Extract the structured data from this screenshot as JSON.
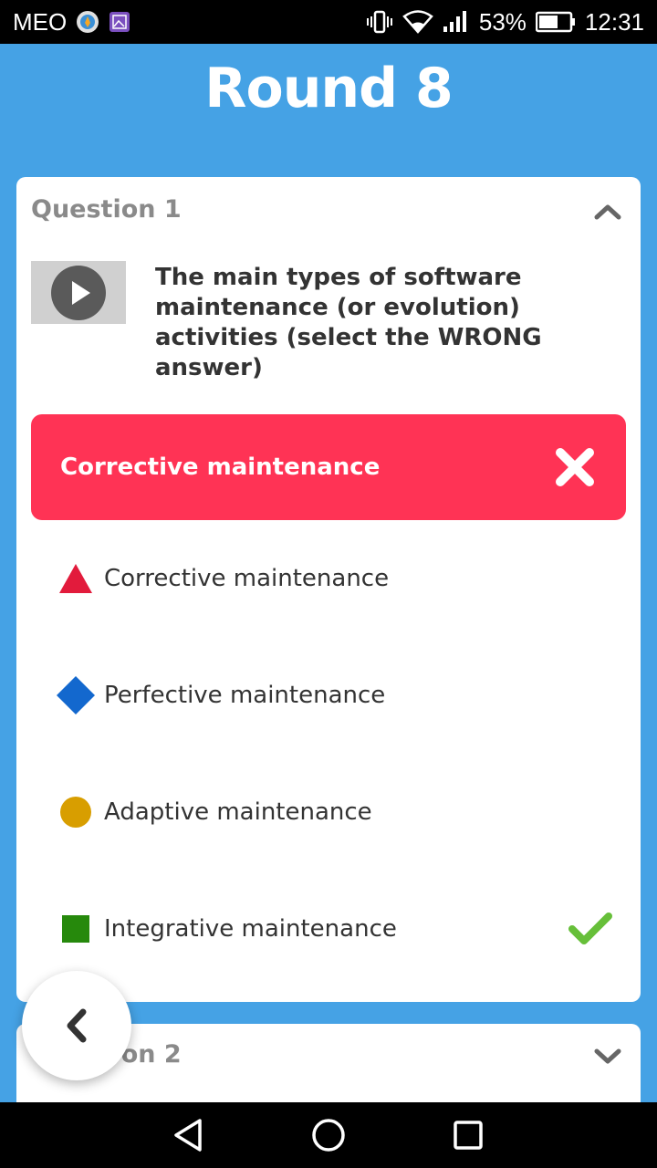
{
  "status_bar": {
    "carrier": "MEO",
    "battery": "53%",
    "time": "12:31",
    "icons": [
      "app-notification-icon",
      "gallery-notification-icon",
      "vibrate-icon",
      "wifi-icon",
      "signal-icon",
      "battery-icon"
    ]
  },
  "header": {
    "title": "Round 8"
  },
  "question_card": {
    "header": "Question 1",
    "question_text": "The main types of software maintenance (or evolution) activities (select the WRONG answer)",
    "selected_answer": {
      "label": "Corrective maintenance",
      "status": "wrong",
      "color": "#ff3355"
    },
    "options": [
      {
        "label": "Corrective maintenance",
        "shape": "triangle",
        "color": "#e21b3c",
        "correct": false
      },
      {
        "label": "Perfective maintenance",
        "shape": "diamond",
        "color": "#1368ce",
        "correct": false
      },
      {
        "label": "Adaptive maintenance",
        "shape": "circle",
        "color": "#d89e00",
        "correct": false
      },
      {
        "label": "Integrative maintenance",
        "shape": "square",
        "color": "#26890c",
        "correct": true
      }
    ]
  },
  "next_card": {
    "header_visible_fragment": "on 2"
  },
  "colors": {
    "background": "#45a2e5",
    "check": "#66bf39"
  }
}
